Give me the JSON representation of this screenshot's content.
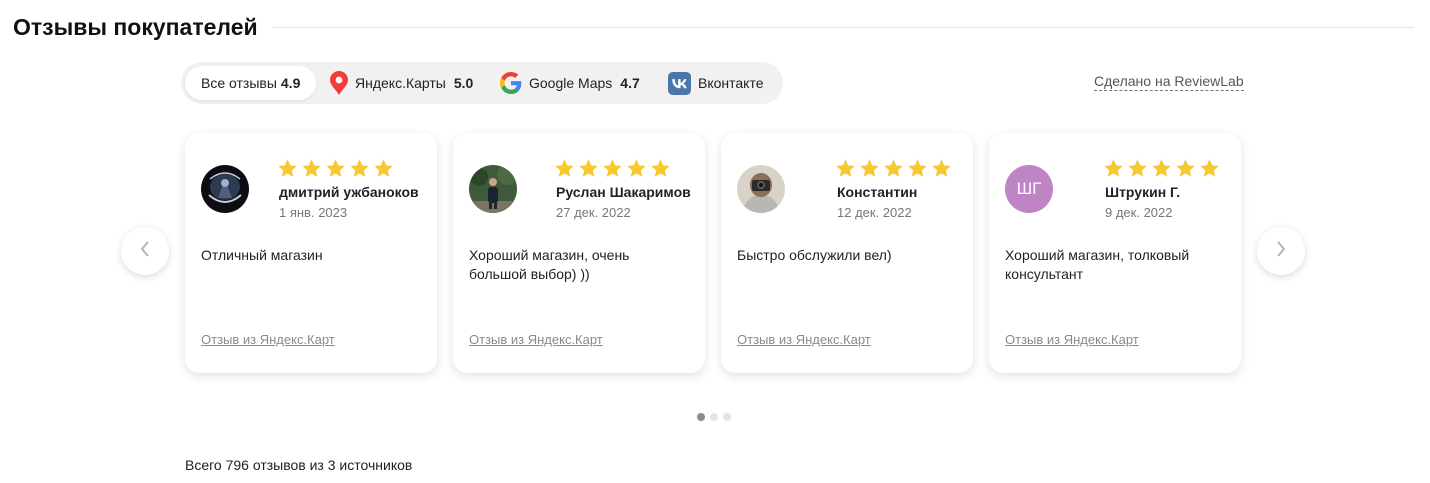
{
  "header": {
    "title": "Отзывы покупателей"
  },
  "sources": [
    {
      "label": "Все отзывы",
      "rating": "4.9",
      "icon": "none",
      "active": true
    },
    {
      "label": "Яндекс.Карты",
      "rating": "5.0",
      "icon": "yandex-maps-pin-icon",
      "active": false
    },
    {
      "label": "Google Maps",
      "rating": "4.7",
      "icon": "google-icon",
      "active": false
    },
    {
      "label": "Вконтакте",
      "rating": "",
      "icon": "vk-icon",
      "active": false
    }
  ],
  "made_with": "Сделано на ReviewLab",
  "reviews": [
    {
      "author": "дмитрий ужбаноков",
      "date": "1 янв. 2023",
      "stars": 5,
      "text": "Отличный магазин",
      "source_link": "Отзыв из Яндекс.Карт",
      "avatar": "photo"
    },
    {
      "author": "Руслан Шакаримов",
      "date": "27 дек. 2022",
      "stars": 5,
      "text": "Хороший магазин, очень большой выбор) ))",
      "source_link": "Отзыв из Яндекс.Карт",
      "avatar": "photo"
    },
    {
      "author": "Константин",
      "date": "12 дек. 2022",
      "stars": 5,
      "text": "Быстро обслужили вел)",
      "source_link": "Отзыв из Яндекс.Карт",
      "avatar": "photo"
    },
    {
      "author": "Штрукин Г.",
      "date": "9 дек. 2022",
      "stars": 5,
      "text": "Хороший магазин, толковый консультант",
      "source_link": "Отзыв из Яндекс.Карт",
      "avatar": "initials",
      "initials": "ШГ",
      "avatar_color": "#bf84c6"
    }
  ],
  "pagination": {
    "pages": 3,
    "current": 1
  },
  "total_text": "Всего 796 отзывов из 3 источников",
  "colors": {
    "star": "#f7c82f",
    "tab_bar_bg": "#f1f1f1",
    "yandex_pin": "#f43b3b",
    "vk": "#4a76a8"
  }
}
